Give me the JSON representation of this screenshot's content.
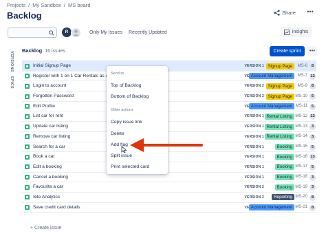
{
  "breadcrumb": [
    "Projects",
    "/",
    "My Sandbox",
    "/",
    "MS board"
  ],
  "page_title": "Backlog",
  "header": {
    "share_label": "Share",
    "more_label": "•••"
  },
  "filters": {
    "avatar_initial": "R",
    "only_my_issues": "Only My Issues",
    "recently_updated": "Recently Updated",
    "insights": "Insights"
  },
  "side_tabs": {
    "versions": "VERSIONS",
    "epics": "EPICS"
  },
  "backlog": {
    "title": "Backlog",
    "count": "16 issues",
    "create_sprint": "Create sprint",
    "more": "•••",
    "create_issue": "+ Create issue"
  },
  "issues": [
    {
      "summary": "Initial Signup Page",
      "version": "VERSION 1",
      "epic": "Signup Page",
      "epic_color": "#f6c900",
      "key": "MS-6",
      "points": "8",
      "selected": true
    },
    {
      "summary": "Register with 1 on 1 Car Rentals as a C",
      "version": "VERSION 1",
      "epic": "Account Management",
      "epic_color": "#4c9aff",
      "key": "MS-7",
      "points": "13"
    },
    {
      "summary": "Login to account",
      "version": "VERSION 2",
      "epic": "Signup Page",
      "epic_color": "#f6c900",
      "key": "MS-9",
      "points": "8"
    },
    {
      "summary": "Forgotten Password",
      "version": "VERSION 2",
      "epic": "Signup Page",
      "epic_color": "#f6c900",
      "key": "MS-10",
      "points": "5"
    },
    {
      "summary": "Edit Profile",
      "version": "VERSION 2",
      "epic": "Account Management",
      "epic_color": "#4c9aff",
      "key": "MS-11",
      "points": "5"
    },
    {
      "summary": "List car for rent",
      "version": "VERSION 1",
      "epic": "Rental Listing",
      "epic_color": "#79e2b2",
      "key": "MS-12",
      "points": "13"
    },
    {
      "summary": "Update car listing",
      "version": "VERSION 1",
      "epic": "Rental Listing",
      "epic_color": "#79e2b2",
      "key": "MS-13",
      "points": "3"
    },
    {
      "summary": "Remove car listing",
      "version": "VERSION 1",
      "epic": "Rental Listing",
      "epic_color": "#79e2b2",
      "key": "MS-14",
      "points": "3"
    },
    {
      "summary": "Search for a car",
      "version": "VERSION 1",
      "epic": "Booking",
      "epic_color": "#79e2b2",
      "key": "MS-15",
      "points": "5"
    },
    {
      "summary": "Book a car",
      "version": "VERSION 1",
      "epic": "Booking",
      "epic_color": "#79e2b2",
      "key": "MS-16",
      "points": "13"
    },
    {
      "summary": "Edit a booking",
      "version": "VERSION 1",
      "epic": "Booking",
      "epic_color": "#79e2b2",
      "key": "MS-17",
      "points": "5"
    },
    {
      "summary": "Cancel a booking",
      "version": "VERSION 1",
      "epic": "Booking",
      "epic_color": "#79e2b2",
      "key": "MS-18",
      "points": "3"
    },
    {
      "summary": "Favourite a car",
      "version": "VERSION 2",
      "epic": "Booking",
      "epic_color": "#79e2b2",
      "key": "MS-19",
      "points": "3"
    },
    {
      "summary": "Site Analytics",
      "version": "VERSION 2",
      "epic": "Reporting",
      "epic_color": "#42526e",
      "epic_text_color": "#ffffff",
      "key": "MS-20",
      "points": "8"
    },
    {
      "summary": "Save credit card details",
      "version": "VERSION 2",
      "epic": "Account Management",
      "epic_color": "#4c9aff",
      "key": "MS-21",
      "points": "8"
    }
  ],
  "context_menu": {
    "section1": "Send to",
    "top_of_backlog": "Top of Backlog",
    "bottom_of_backlog": "Bottom of Backlog",
    "section2": "Other actions",
    "copy_issue_link": "Copy issue link",
    "delete": "Delete",
    "add_flag": "Add flag",
    "split_issue": "Split issue",
    "print_selected_card": "Print selected card"
  },
  "colors": {
    "primary": "#0052cc",
    "annotation_arrow": "#de350b"
  }
}
